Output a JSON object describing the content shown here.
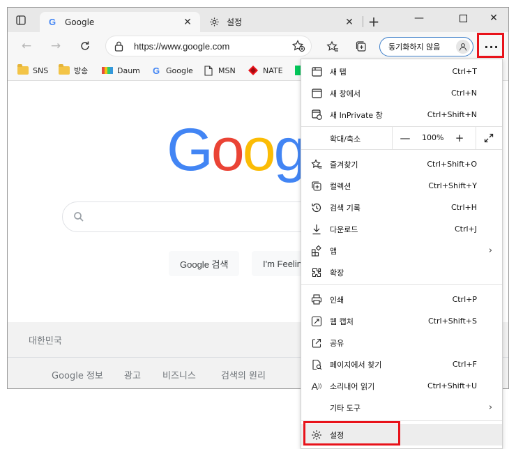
{
  "browser": {
    "tabs": [
      {
        "title": "Google",
        "favicon": "G"
      },
      {
        "title": "설정"
      }
    ],
    "address": {
      "url": "https://www.google.com"
    },
    "sync_button_label": "동기화하지 않음",
    "favorites": [
      {
        "label": "SNS",
        "icon": "folder-icon"
      },
      {
        "label": "방송",
        "icon": "folder-icon"
      },
      {
        "label": "Daum",
        "icon": "daum-icon"
      },
      {
        "label": "Google",
        "icon": "google-icon"
      },
      {
        "label": "MSN",
        "icon": "page-icon"
      },
      {
        "label": "NATE",
        "icon": "nate-icon"
      }
    ]
  },
  "page": {
    "logo": "Google",
    "search_button": "Google 검색",
    "lucky_button": "I'm Feeling Lucky",
    "country": "대한민국",
    "footer_links": [
      "Google 정보",
      "광고",
      "비즈니스",
      "검색의 원리"
    ]
  },
  "menu": {
    "new_tab": {
      "label": "새 탭",
      "shortcut": "Ctrl+T"
    },
    "new_window": {
      "label": "새 창에서",
      "shortcut": "Ctrl+N"
    },
    "new_inprivate": {
      "label": "새 InPrivate 창",
      "shortcut": "Ctrl+Shift+N"
    },
    "zoom": {
      "label": "확대/축소",
      "minus": "—",
      "value": "100%",
      "plus": "+"
    },
    "favorites": {
      "label": "즐겨찾기",
      "shortcut": "Ctrl+Shift+O"
    },
    "collections": {
      "label": "컬렉션",
      "shortcut": "Ctrl+Shift+Y"
    },
    "history": {
      "label": "검색 기록",
      "shortcut": "Ctrl+H"
    },
    "downloads": {
      "label": "다운로드",
      "shortcut": "Ctrl+J"
    },
    "apps": {
      "label": "앱"
    },
    "extensions": {
      "label": "확장"
    },
    "print": {
      "label": "인쇄",
      "shortcut": "Ctrl+P"
    },
    "web_capture": {
      "label": "웹 캡처",
      "shortcut": "Ctrl+Shift+S"
    },
    "share": {
      "label": "공유"
    },
    "find": {
      "label": "페이지에서 찾기",
      "shortcut": "Ctrl+F"
    },
    "read_aloud": {
      "label": "소리내어 읽기",
      "shortcut": "Ctrl+Shift+U"
    },
    "more_tools": {
      "label": "기타 도구"
    },
    "settings": {
      "label": "설정"
    }
  },
  "colors": {
    "highlight": "#e8121a",
    "sync_border": "#3c7ec9"
  }
}
